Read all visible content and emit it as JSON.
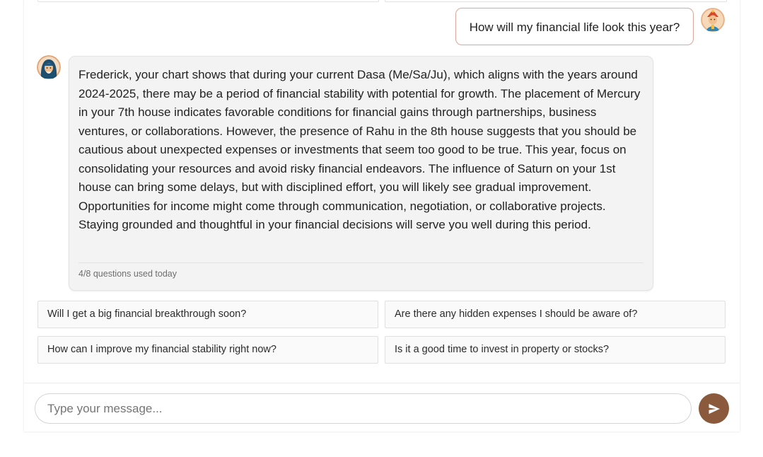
{
  "colors": {
    "accent": "#8b5a3c",
    "user_bubble_border": "#d8a89b",
    "bot_bubble_bg": "#f3f3f3"
  },
  "icons": {
    "user_avatar": "user-avatar-icon",
    "bot_avatar": "astrologer-avatar-icon",
    "send": "send-icon"
  },
  "chat": {
    "user_message": "How will my financial life look this year?",
    "bot_message": "Frederick, your chart shows that during your current Dasa (Me/Sa/Ju), which aligns with the years around 2024-2025, there may be a period of financial stability with potential for growth. The placement of Mercury in your 7th house indicates favorable conditions for financial gains through partnerships, business ventures, or collaborations. However, the presence of Rahu in the 8th house suggests that you should be cautious about unexpected expenses or investments that seem too good to be true. This year, focus on consolidating your resources and avoid risky financial endeavors. The influence of Saturn on your 1st house can bring some delays, but with disciplined effort, you will likely see gradual improvement. Opportunities for income might come through communication, negotiation, or collaborative projects. Staying grounded and thoughtful in your financial decisions will serve you well during this period.",
    "usage": "4/8 questions used today"
  },
  "suggestions": [
    "Will I get a big financial breakthrough soon?",
    "Are there any hidden expenses I should be aware of?",
    "How can I improve my financial stability right now?",
    "Is it a good time to invest in property or stocks?"
  ],
  "composer": {
    "placeholder": "Type your message..."
  }
}
